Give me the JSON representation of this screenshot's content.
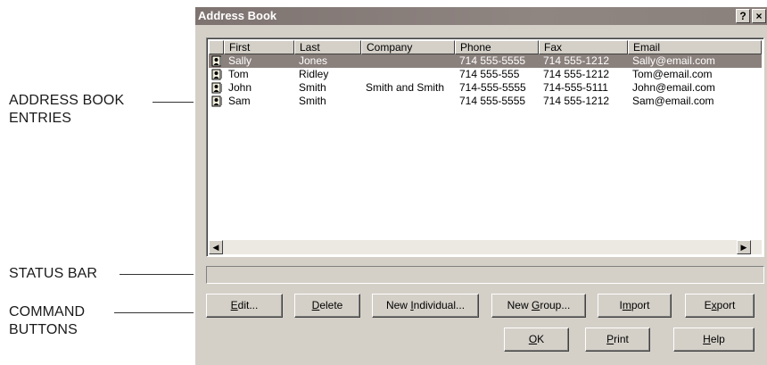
{
  "callouts": {
    "entries_line1": "ADDRESS BOOK",
    "entries_line2": "ENTRIES",
    "status_bar": "STATUS BAR",
    "command_line1": "COMMAND",
    "command_line2": "BUTTONS"
  },
  "window": {
    "title": "Address Book",
    "help_glyph": "?",
    "close_glyph": "×"
  },
  "list": {
    "columns": [
      "First",
      "Last",
      "Company",
      "Phone",
      "Fax",
      "Email"
    ],
    "rows": [
      {
        "first": "Sally",
        "last": "Jones",
        "company": "",
        "phone": "714 555-5555",
        "fax": "714 555-1212",
        "email": "Sally@email.com",
        "selected": true
      },
      {
        "first": "Tom",
        "last": "Ridley",
        "company": "",
        "phone": "714 555-555",
        "fax": "714 555-1212",
        "email": "Tom@email.com",
        "selected": false
      },
      {
        "first": "John",
        "last": "Smith",
        "company": "Smith and Smith",
        "phone": "714-555-5555",
        "fax": "714-555-5111",
        "email": "John@email.com",
        "selected": false
      },
      {
        "first": "Sam",
        "last": "Smith",
        "company": "",
        "phone": "714 555-5555",
        "fax": "714 555-1212",
        "email": "Sam@email.com",
        "selected": false
      }
    ],
    "scroll_left_glyph": "◀",
    "scroll_right_glyph": "▶"
  },
  "buttons": {
    "edit": {
      "pre": "",
      "key": "E",
      "post": "dit..."
    },
    "delete": {
      "pre": "",
      "key": "D",
      "post": "elete"
    },
    "new_individual": {
      "pre": "New ",
      "key": "I",
      "post": "ndividual..."
    },
    "new_group": {
      "pre": "New ",
      "key": "G",
      "post": "roup..."
    },
    "import": {
      "pre": "I",
      "key": "m",
      "post": "port"
    },
    "export": {
      "pre": "E",
      "key": "x",
      "post": "port"
    },
    "ok": {
      "pre": "",
      "key": "O",
      "post": "K"
    },
    "print": {
      "pre": "",
      "key": "P",
      "post": "rint"
    },
    "help": {
      "pre": "",
      "key": "H",
      "post": "elp"
    }
  },
  "icons": {
    "row_icon": "person-card-icon",
    "help": "help-icon",
    "close": "close-icon"
  }
}
